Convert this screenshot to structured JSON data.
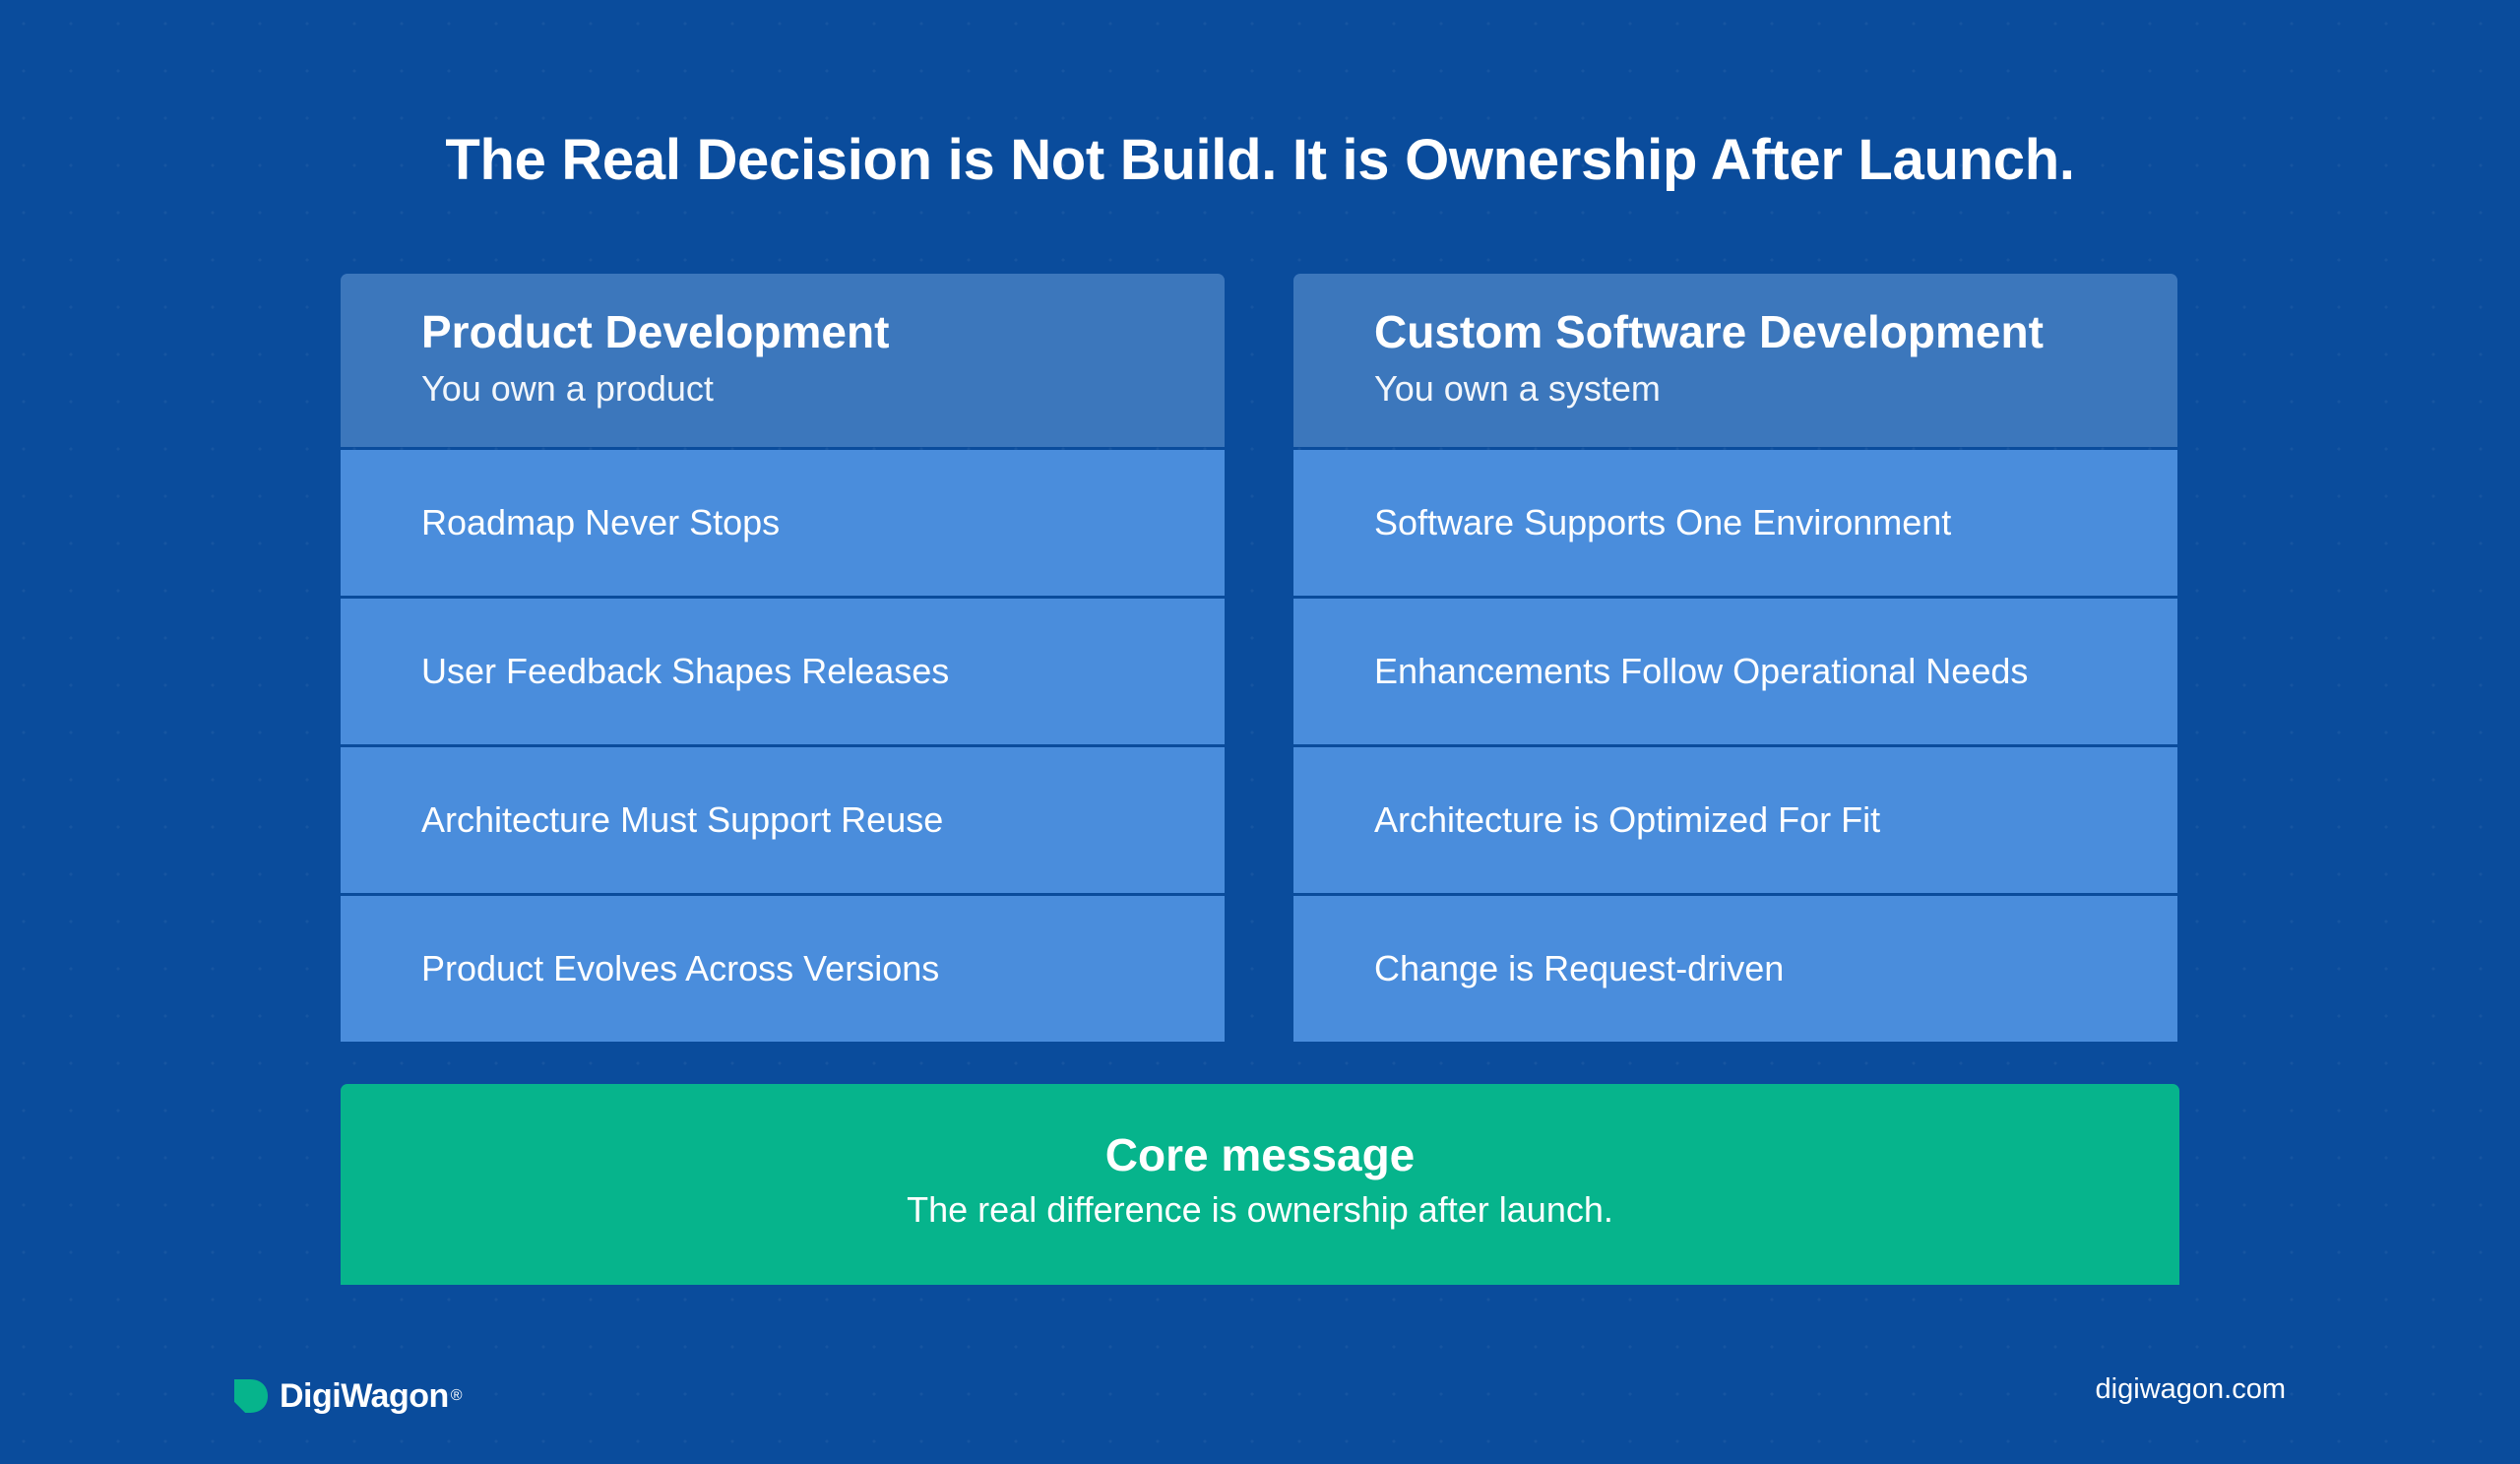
{
  "title": "The Real Decision is Not Build. It is Ownership After Launch.",
  "columns": [
    {
      "title": "Product Development",
      "subtitle": "You own a product",
      "items": [
        "Roadmap Never Stops",
        "User Feedback Shapes Releases",
        "Architecture Must Support Reuse",
        "Product Evolves Across Versions"
      ]
    },
    {
      "title": "Custom Software Development",
      "subtitle": "You own a system",
      "items": [
        "Software Supports One Environment",
        "Enhancements Follow Operational Needs",
        "Architecture is Optimized For Fit",
        "Change is Request-driven"
      ]
    }
  ],
  "core": {
    "title": "Core message",
    "text": "The real difference is ownership after launch."
  },
  "footer": {
    "brand": "DigiWagon",
    "registered": "®",
    "website": "digiwagon.com"
  },
  "colors": {
    "background": "#0a4c9c",
    "header": "#3c77bc",
    "item": "#4a8ddc",
    "core": "#06b48c",
    "logo": "#06b48c"
  },
  "icons": {
    "logo": "digiwagon-logo-icon"
  }
}
